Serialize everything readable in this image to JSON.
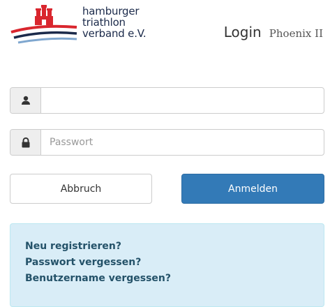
{
  "brand": {
    "line1": "hamburger",
    "line2": "triathlon",
    "line3": "verband e.V."
  },
  "heading": {
    "title": "Login",
    "subtitle": "Phoenix II"
  },
  "form": {
    "username": {
      "icon": "user-icon",
      "value": "",
      "placeholder": ""
    },
    "password": {
      "icon": "lock-icon",
      "value": "",
      "placeholder": "Passwort"
    }
  },
  "buttons": {
    "cancel_label": "Abbruch",
    "login_label": "Anmelden"
  },
  "links": {
    "register": "Neu registrieren?",
    "forgot_password": "Passwort vergessen?",
    "forgot_username": "Benutzername vergessen?"
  },
  "colors": {
    "primary": "#337ab7",
    "info_bg": "#d9edf7",
    "info_text": "#245269",
    "logo_red": "#d9262e",
    "logo_navy": "#1b2a4a"
  }
}
